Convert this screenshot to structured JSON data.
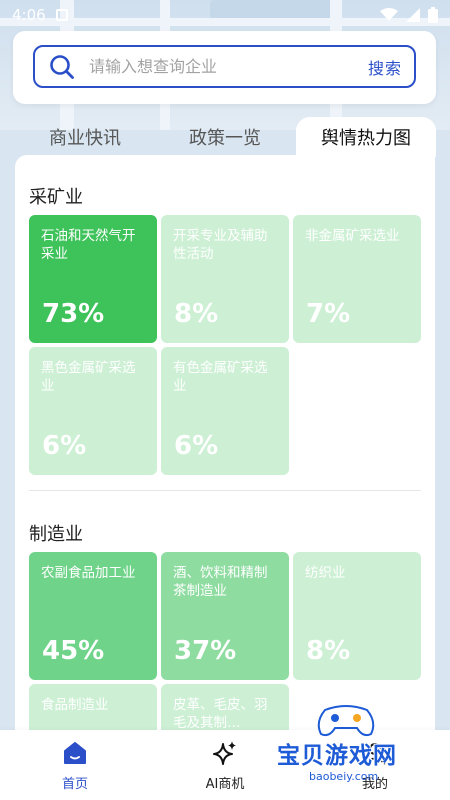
{
  "status_bar": {
    "time": "4:06"
  },
  "search": {
    "placeholder": "请输入想查询企业",
    "button_label": "搜索"
  },
  "tabs": [
    {
      "label": "商业快讯",
      "active": false
    },
    {
      "label": "政策一览",
      "active": false
    },
    {
      "label": "舆情热力图",
      "active": true
    }
  ],
  "sections": [
    {
      "title": "采矿业",
      "items": [
        {
          "name": "石油和天然气开采业",
          "percent": "73%"
        },
        {
          "name": "开采专业及辅助性活动",
          "percent": "8%"
        },
        {
          "name": "非金属矿采选业",
          "percent": "7%"
        },
        {
          "name": "黑色金属矿采选业",
          "percent": "6%"
        },
        {
          "name": "有色金属矿采选业",
          "percent": "6%"
        }
      ]
    },
    {
      "title": "制造业",
      "items": [
        {
          "name": "农副食品加工业",
          "percent": "45%"
        },
        {
          "name": "酒、饮料和精制茶制造业",
          "percent": "37%"
        },
        {
          "name": "纺织业",
          "percent": "8%"
        },
        {
          "name": "食品制造业",
          "percent": ""
        },
        {
          "name": "皮革、毛皮、羽毛及其制…",
          "percent": ""
        }
      ]
    }
  ],
  "bottom_nav": [
    {
      "label": "首页",
      "icon": "home-icon",
      "active": true
    },
    {
      "label": "AI商机",
      "icon": "sparkle-icon",
      "active": false
    },
    {
      "label": "我的",
      "icon": "user-icon",
      "active": false
    }
  ],
  "watermark": {
    "text": "宝贝游戏网",
    "url": "baobeiy.com"
  },
  "colors": {
    "accent": "#2b4fc9",
    "heat_high": "#3ec25a",
    "heat_mid": "#6fd389",
    "heat_mid2": "#97dfa8",
    "heat_low": "#b9eac5",
    "heat_lowest": "#cdf0d5"
  }
}
